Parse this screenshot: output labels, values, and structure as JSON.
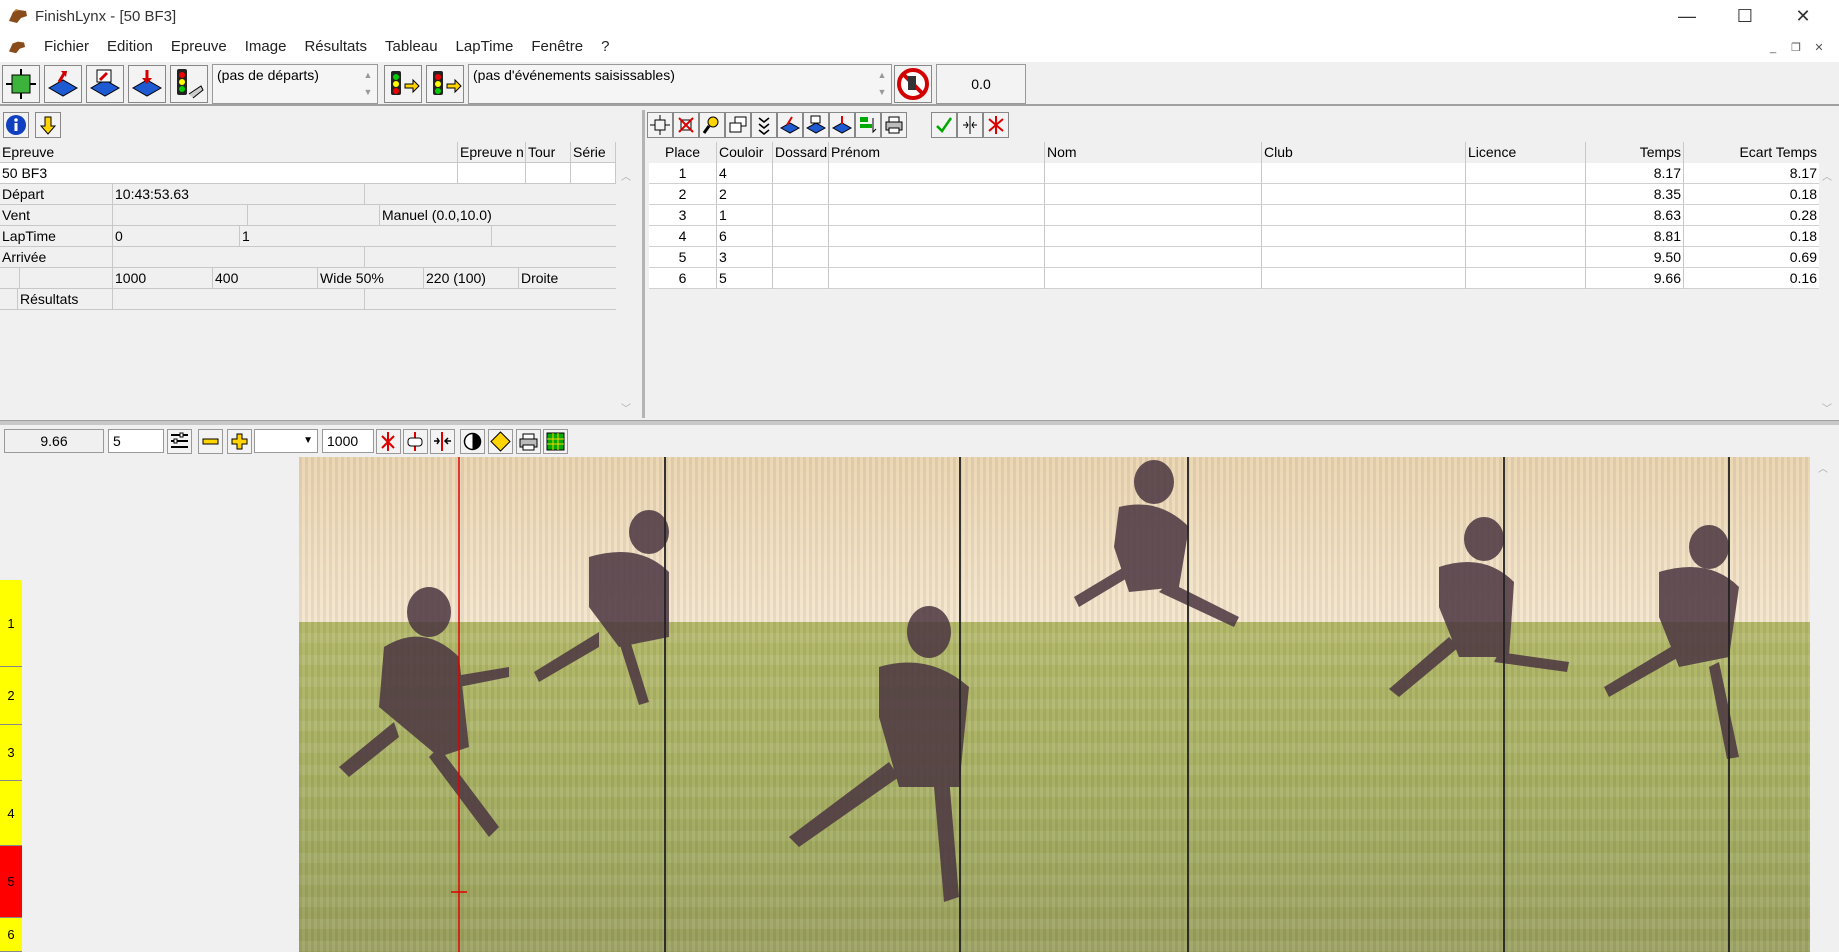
{
  "window": {
    "title": "FinishLynx - [50 BF3]"
  },
  "menu": [
    "Fichier",
    "Edition",
    "Epreuve",
    "Image",
    "Résultats",
    "Tableau",
    "LapTime",
    "Fenêtre",
    "?"
  ],
  "toolbar": {
    "starts_combo": "(pas de départs)",
    "events_combo": "(pas d'événements saisissables)",
    "timer_value": "0.0"
  },
  "event_panel": {
    "headers": {
      "epreuve": "Epreuve",
      "epreuve_n": "Epreuve n",
      "tour": "Tour",
      "serie": "Série"
    },
    "event_name": "50 BF3",
    "depart_label": "Départ",
    "depart_value": "10:43:53.63",
    "vent_label": "Vent",
    "vent_value": "Manuel (0.0,10.0)",
    "laptime_label": "LapTime",
    "laptime_a": "0",
    "laptime_b": "1",
    "arrivee_label": "Arrivée",
    "cam": {
      "a": "1000",
      "b": "400",
      "c": "Wide 50%",
      "d": "220  (100)",
      "e": "Droite"
    },
    "resultats_label": "Résultats"
  },
  "results": {
    "columns": [
      "Place",
      "Couloir",
      "Dossard",
      "Prénom",
      "Nom",
      "Club",
      "Licence",
      "Temps",
      "Ecart Temps"
    ],
    "rows": [
      {
        "place": "1",
        "couloir": "4",
        "temps": "8.17",
        "ecart": "8.17"
      },
      {
        "place": "2",
        "couloir": "2",
        "temps": "8.35",
        "ecart": "0.18"
      },
      {
        "place": "3",
        "couloir": "1",
        "temps": "8.63",
        "ecart": "0.28"
      },
      {
        "place": "4",
        "couloir": "6",
        "temps": "8.81",
        "ecart": "0.18"
      },
      {
        "place": "5",
        "couloir": "3",
        "temps": "9.50",
        "ecart": "0.69"
      },
      {
        "place": "6",
        "couloir": "5",
        "temps": "9.66",
        "ecart": "0.16"
      }
    ]
  },
  "image_toolbar": {
    "time_value": "9.66",
    "lane_field": "5",
    "zoom_field": "1000"
  },
  "lanes": [
    {
      "label": "1",
      "color": "#ffff00"
    },
    {
      "label": "2",
      "color": "#ffff00"
    },
    {
      "label": "3",
      "color": "#ffff00"
    },
    {
      "label": "4",
      "color": "#ffff00"
    },
    {
      "label": "5",
      "color": "#ff0000"
    },
    {
      "label": "6",
      "color": "#ffff00"
    }
  ]
}
